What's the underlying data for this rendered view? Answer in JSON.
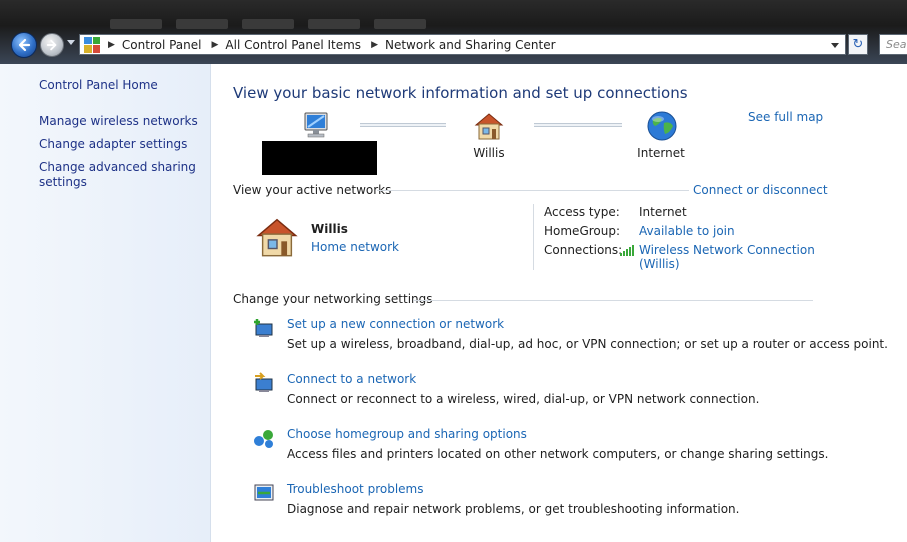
{
  "breadcrumb": {
    "items": [
      "Control Panel",
      "All Control Panel Items",
      "Network and Sharing Center"
    ]
  },
  "search": {
    "placeholder": "Sea"
  },
  "sidebar": {
    "items": [
      {
        "label": "Control Panel Home"
      },
      {
        "label": "Manage wireless networks"
      },
      {
        "label": "Change adapter settings"
      },
      {
        "label": "Change advanced sharing settings"
      }
    ]
  },
  "main": {
    "heading": "View your basic network information and set up connections",
    "see_full_map": "See full map",
    "map_nodes": {
      "network": "Willis",
      "internet": "Internet"
    },
    "active_networks": {
      "title": "View your active networks",
      "connect_link": "Connect or disconnect",
      "network_name": "Willis",
      "network_type": "Home network",
      "access_type_label": "Access type:",
      "access_type_value": "Internet",
      "homegroup_label": "HomeGroup:",
      "homegroup_value": "Available to join",
      "connections_label": "Connections:",
      "connections_value_line1": "Wireless Network Connection",
      "connections_value_line2": "(Willis)"
    },
    "settings": {
      "title": "Change your networking settings",
      "tasks": [
        {
          "title": "Set up a new connection or network",
          "desc": "Set up a wireless, broadband, dial-up, ad hoc, or VPN connection; or set up a router or access point."
        },
        {
          "title": "Connect to a network",
          "desc": "Connect or reconnect to a wireless, wired, dial-up, or VPN network connection."
        },
        {
          "title": "Choose homegroup and sharing options",
          "desc": "Access files and printers located on other network computers, or change sharing settings."
        },
        {
          "title": "Troubleshoot problems",
          "desc": "Diagnose and repair network problems, or get troubleshooting information."
        }
      ]
    }
  },
  "colors": {
    "link": "#1b66b4",
    "sidebar_link": "#1e3287",
    "heading": "#1e3a78",
    "signal": "#3aa83a"
  }
}
